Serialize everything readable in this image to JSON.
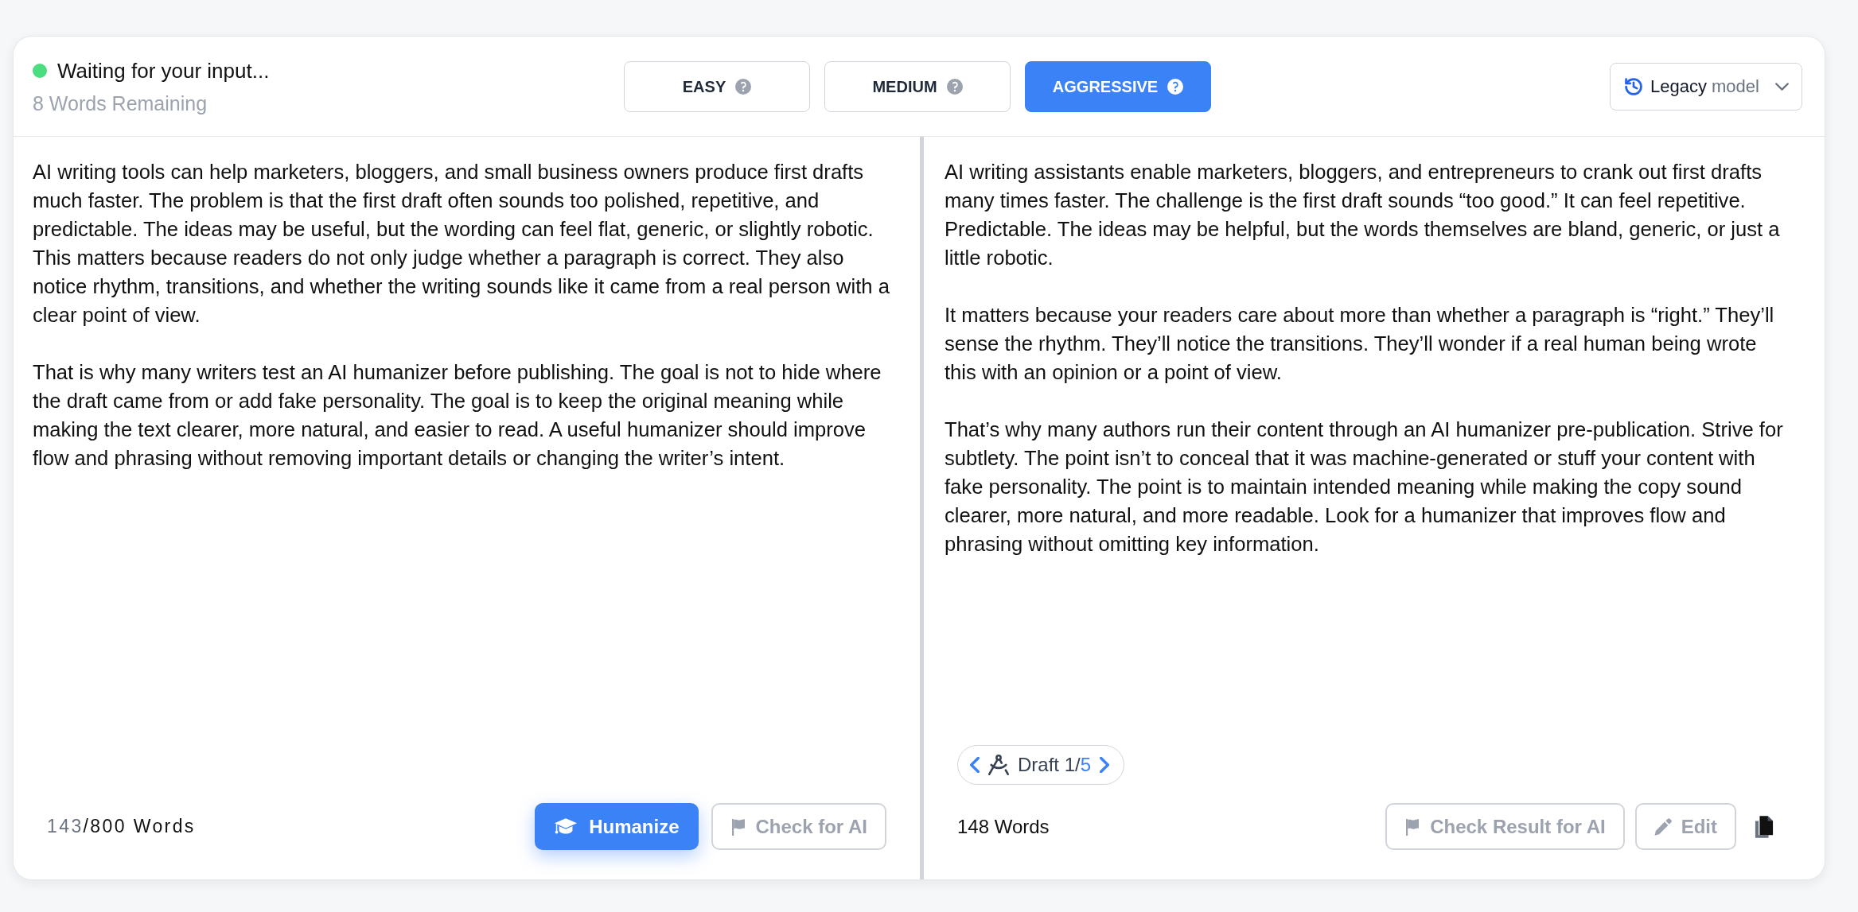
{
  "status": {
    "text": "Waiting for your input...",
    "remaining": "8 Words Remaining"
  },
  "modes": [
    {
      "label": "EASY",
      "selected": false
    },
    {
      "label": "MEDIUM",
      "selected": false
    },
    {
      "label": "AGGRESSIVE",
      "selected": true
    }
  ],
  "model_dropdown": {
    "name": "Legacy",
    "suffix": "model"
  },
  "input_panel": {
    "paragraphs": [
      "AI writing tools can help marketers, bloggers, and small business owners produce first drafts much faster. The problem is that the first draft often sounds too polished, repetitive, and predictable. The ideas may be useful, but the wording can feel flat, generic, or slightly robotic. This matters because readers do not only judge whether a paragraph is correct. They also notice rhythm, transitions, and whether the writing sounds like it came from a real person with a clear point of view.",
      "That is why many writers test an AI humanizer before publishing. The goal is not to hide where the draft came from or add fake personality. The goal is to keep the original meaning while making the text clearer, more natural, and easier to read. A useful humanizer should improve flow and phrasing without removing important details or changing the writer’s intent."
    ],
    "word_count": {
      "count": "143",
      "rest": "/800 Words"
    },
    "humanize_button": {
      "label": "Humanize"
    },
    "check_button": {
      "label": "Check for AI",
      "disabled": true
    }
  },
  "output_panel": {
    "paragraphs": [
      "AI writing assistants enable marketers, bloggers, and entrepreneurs to crank out first drafts many times faster. The challenge is the first draft sounds “too good.” It can feel repetitive. Predictable. The ideas may be helpful, but the words themselves are bland, generic, or just a little robotic.",
      "It matters because your readers care about more than whether a paragraph is “right.” They’ll sense the rhythm. They’ll notice the transitions. They’ll wonder if a real human being wrote this with an opinion or a point of view.",
      "That’s why many authors run their content through an AI humanizer pre-publication. Strive for subtlety. The point isn’t to conceal that it was machine-generated or stuff your content with fake personality. The point is to maintain intended meaning while making the copy sound clearer, more natural, and more readable. Look for a humanizer that improves flow and phrasing without omitting key information."
    ],
    "draft": {
      "label": "Draft 1/",
      "total": "5"
    },
    "word_count": "148 Words",
    "check_button": {
      "label": "Check Result for AI",
      "disabled": true
    },
    "edit_button": {
      "label": "Edit",
      "disabled": true
    }
  }
}
